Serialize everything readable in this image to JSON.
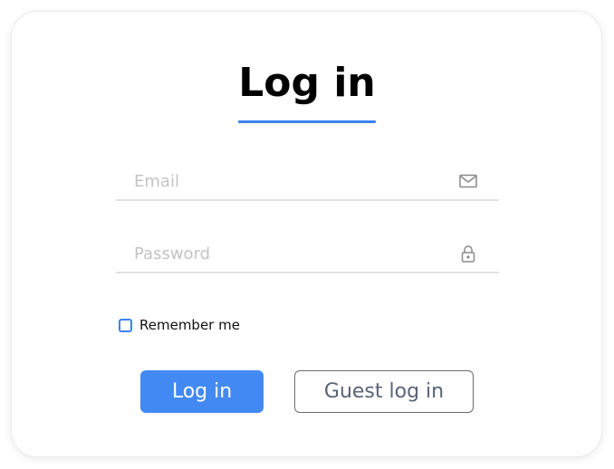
{
  "title": "Log in",
  "form": {
    "email": {
      "placeholder": "Email",
      "value": "",
      "icon": "mail-icon"
    },
    "password": {
      "placeholder": "Password",
      "value": "",
      "icon": "lock-icon"
    },
    "remember": {
      "label": "Remember me",
      "checked": false
    }
  },
  "buttons": {
    "login_label": "Log in",
    "guest_label": "Guest log in"
  },
  "colors": {
    "accent": "#4289f4",
    "underline": "#3c82f0",
    "guest_text": "#5a6378"
  }
}
